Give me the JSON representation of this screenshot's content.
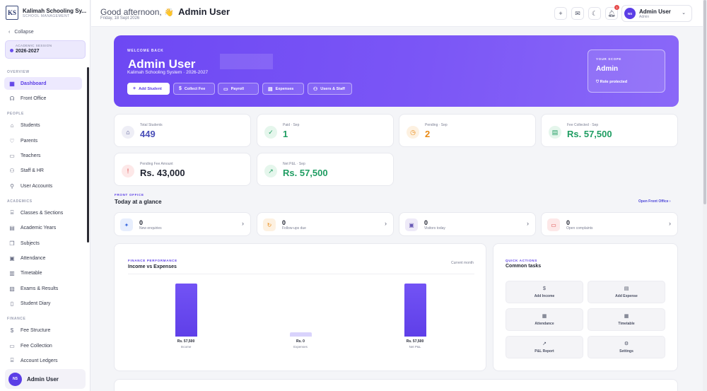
{
  "sidebar": {
    "brand_title": "Kalimah Schooling Sy...",
    "brand_sub": "SCHOOL MANAGEMENT",
    "logo": "KS",
    "collapse": "Collapse",
    "session_label": "ACADEMIC SESSION",
    "session_value": "2026-2027",
    "sections": [
      "OVERVIEW",
      "PEOPLE",
      "ACADEMICS",
      "FINANCE"
    ],
    "items": [
      {
        "label": "Dashboard",
        "icon": "grid-icon"
      },
      {
        "label": "Front Office",
        "icon": "headset-icon"
      },
      {
        "label": "Students",
        "icon": "graduation-cap-icon"
      },
      {
        "label": "Parents",
        "icon": "heart-icon"
      },
      {
        "label": "Teachers",
        "icon": "monitor-icon"
      },
      {
        "label": "Staff & HR",
        "icon": "briefcase-icon"
      },
      {
        "label": "User Accounts",
        "icon": "user-cog-icon"
      },
      {
        "label": "Classes & Sections",
        "icon": "classes-icon"
      },
      {
        "label": "Academic Years",
        "icon": "calendar-icon"
      },
      {
        "label": "Subjects",
        "icon": "book-icon"
      },
      {
        "label": "Attendance",
        "icon": "calendar-check-icon"
      },
      {
        "label": "Timetable",
        "icon": "timetable-icon"
      },
      {
        "label": "Exams & Results",
        "icon": "clipboard-icon"
      },
      {
        "label": "Student Diary",
        "icon": "diary-icon"
      },
      {
        "label": "Fee Structure",
        "icon": "dollar-circle-icon"
      },
      {
        "label": "Fee Collection",
        "icon": "wallet-icon"
      },
      {
        "label": "Account Ledgers",
        "icon": "ledger-icon"
      }
    ],
    "user": {
      "initials": "NS",
      "name": "Admin User"
    }
  },
  "topbar": {
    "greeting": "Good afternoon,",
    "name": "Admin User",
    "date": "Friday, 18 Sept 2026",
    "notif_count": "1",
    "user": {
      "initials": "NS",
      "name": "Admin User",
      "role": "Admin"
    }
  },
  "hero": {
    "eyebrow": "WELCOME BACK",
    "name": "Admin User",
    "sub": "Kalimah Schooling System · 2026-2027",
    "buttons": [
      "Add Student",
      "Collect Fee",
      "Payroll",
      "Expenses",
      "Users & Staff"
    ],
    "scope_label": "YOUR SCOPE",
    "scope_value": "Admin",
    "scope_note": "Role protected"
  },
  "stats": [
    {
      "label": "Total Students",
      "value": "449",
      "color": "#4a4fb8"
    },
    {
      "label": "Paid · Sep",
      "value": "1",
      "color": "#1f9d62"
    },
    {
      "label": "Pending · Sep",
      "value": "2",
      "color": "#e98a15"
    },
    {
      "label": "Fee Collected · Sep",
      "value": "Rs. 57,500",
      "color": "#1f9d62"
    },
    {
      "label": "Pending Fee Amount",
      "value": "Rs. 43,000",
      "color": "#1f2330"
    },
    {
      "label": "Net P&L · Sep",
      "value": "Rs. 57,500",
      "color": "#1f9d62"
    }
  ],
  "front_office": {
    "eyebrow": "FRONT OFFICE",
    "title": "Today at a glance",
    "link": "Open Front Office",
    "items": [
      {
        "value": "0",
        "label": "New enquiries"
      },
      {
        "value": "0",
        "label": "Follow-ups due"
      },
      {
        "value": "0",
        "label": "Visitors today"
      },
      {
        "value": "0",
        "label": "Open complaints"
      }
    ]
  },
  "finance": {
    "eyebrow": "FINANCE PERFORMANCE",
    "title": "Income vs Expenses",
    "period": "Current month"
  },
  "chart_data": {
    "type": "bar",
    "categories": [
      "Income",
      "Expenses",
      "Net P&L"
    ],
    "values": [
      57500,
      0,
      57500
    ],
    "value_labels": [
      "Rs. 57,500",
      "Rs. 0",
      "Rs. 57,500"
    ],
    "title": "Income vs Expenses"
  },
  "quick_actions": {
    "eyebrow": "QUICK ACTIONS",
    "title": "Common tasks",
    "items": [
      "Add Income",
      "Add Expense",
      "Attendance",
      "Timetable",
      "P&L Report",
      "Settings"
    ]
  }
}
